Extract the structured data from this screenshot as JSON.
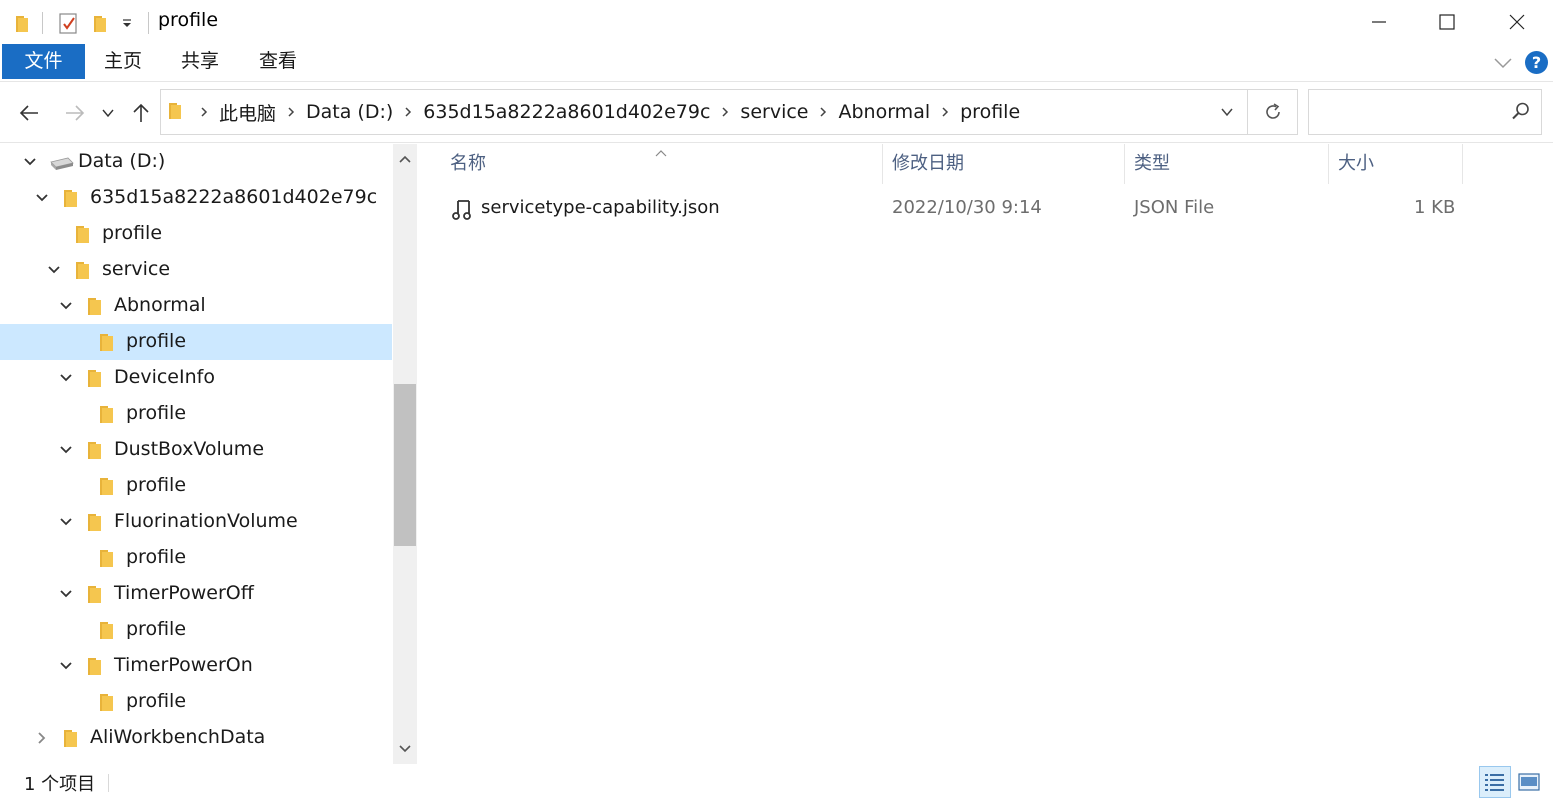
{
  "window": {
    "title": "profile"
  },
  "ribbon": {
    "tabs": [
      "文件",
      "主页",
      "共享",
      "查看"
    ],
    "help": "?"
  },
  "address": {
    "crumbs": [
      "此电脑",
      "Data (D:)",
      "635d15a8222a8601d402e79c",
      "service",
      "Abnormal",
      "profile"
    ]
  },
  "search": {
    "placeholder": ""
  },
  "tree": {
    "drive": "Data (D:)",
    "root_folder": "635d15a8222a8601d402e79c",
    "profile_top": "profile",
    "service": "service",
    "abnormal": "Abnormal",
    "abnormal_profile": "profile",
    "deviceinfo": "DeviceInfo",
    "deviceinfo_profile": "profile",
    "dustbox": "DustBoxVolume",
    "dustbox_profile": "profile",
    "fluorination": "FluorinationVolume",
    "fluorination_profile": "profile",
    "timeroff": "TimerPowerOff",
    "timeroff_profile": "profile",
    "timeron": "TimerPowerOn",
    "timeron_profile": "profile",
    "aliworkbench": "AliWorkbenchData"
  },
  "columns": {
    "name": "名称",
    "date": "修改日期",
    "type": "类型",
    "size": "大小"
  },
  "files": [
    {
      "name": "servicetype-capability.json",
      "date": "2022/10/30 9:14",
      "type": "JSON File",
      "size": "1 KB"
    }
  ],
  "status": {
    "count": "1 个项目"
  },
  "colors": {
    "accent": "#1a6dc4",
    "selection": "#cce8ff",
    "folder": "#f5c64f",
    "header_text": "#4d6082"
  }
}
